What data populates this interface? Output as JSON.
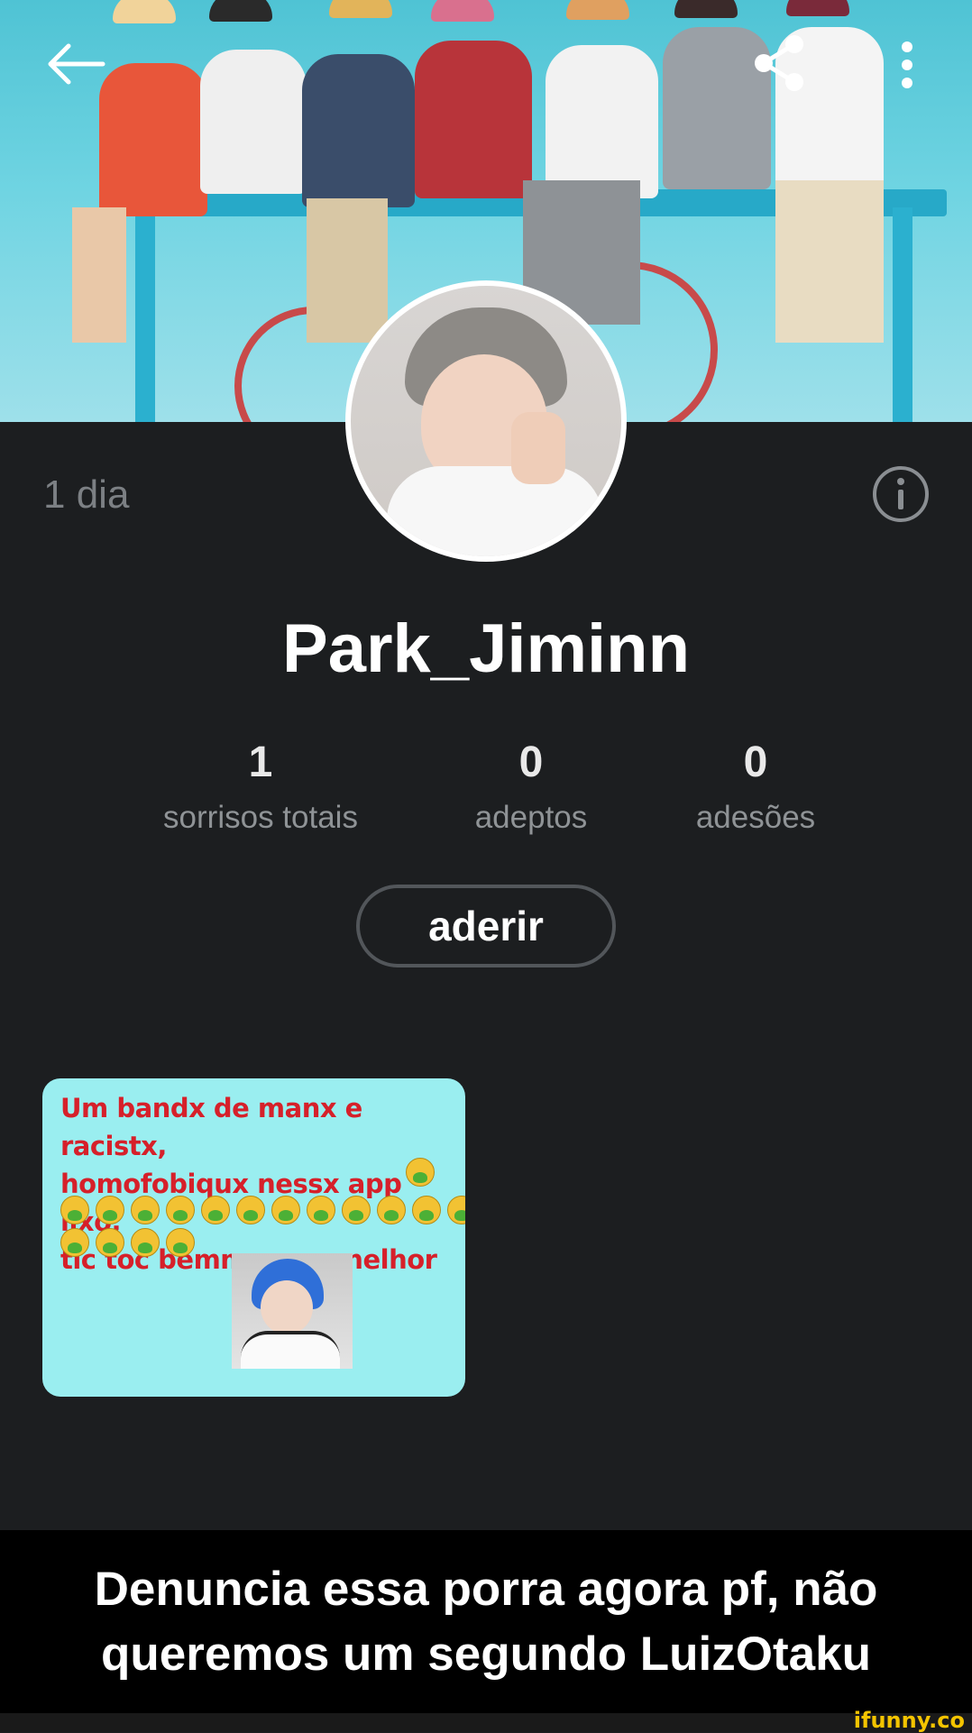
{
  "header": {
    "back_icon": "arrow-left-icon",
    "share_icon": "share-icon",
    "more_icon": "more-vertical-icon"
  },
  "profile": {
    "time_ago": "1 dia",
    "username": "Park_Jiminn",
    "info_icon": "info-icon"
  },
  "stats": [
    {
      "value": "1",
      "label": "sorrisos totais"
    },
    {
      "value": "0",
      "label": "adeptos"
    },
    {
      "value": "0",
      "label": "adesões"
    }
  ],
  "follow_button": {
    "label": "aderir"
  },
  "post": {
    "lines": [
      "Um bandx de manx e racistx,",
      "homofobiqux nessx app lixo,",
      "tic toc bemmmmm melhor"
    ]
  },
  "caption": "Denuncia essa porra agora pf, não queremos um segundo LuizOtaku",
  "watermark": "ifunny.co",
  "colors": {
    "background": "#1c1e20",
    "post_bg": "#9aeef0",
    "post_text": "#d6202a",
    "watermark": "#f4c400"
  }
}
